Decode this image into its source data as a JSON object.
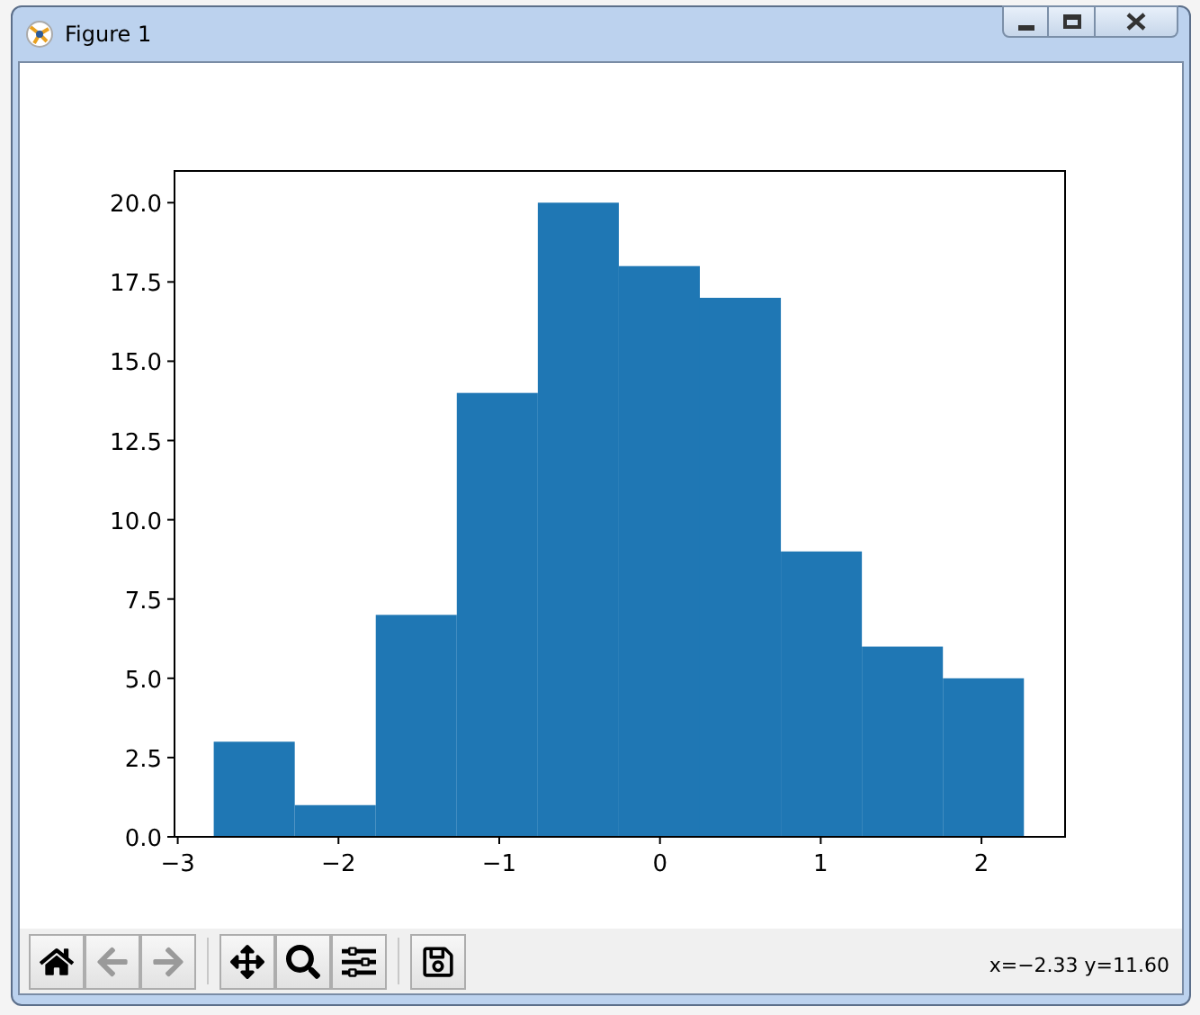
{
  "window": {
    "title": "Figure 1",
    "controls": [
      {
        "kind": "minimize"
      },
      {
        "kind": "maximize"
      },
      {
        "kind": "close"
      }
    ]
  },
  "figure": {
    "chart_data": {
      "type": "bar",
      "x": [
        -2.524,
        -2.02,
        -1.516,
        -1.012,
        -0.508,
        -0.004,
        0.5,
        1.004,
        1.508,
        2.012
      ],
      "values": [
        3,
        1,
        7,
        14,
        20,
        18,
        17,
        9,
        6,
        5
      ],
      "color": "#1f77b4",
      "xlim": [
        -3.02,
        2.52
      ],
      "ylim": [
        0,
        21
      ],
      "xticks": [
        {
          "value": -3,
          "label": "−3"
        },
        {
          "value": -2,
          "label": "−2"
        },
        {
          "value": -1,
          "label": "−1"
        },
        {
          "value": 0,
          "label": "0"
        },
        {
          "value": 1,
          "label": "1"
        },
        {
          "value": 2,
          "label": "2"
        }
      ],
      "yticks": [
        {
          "value": 0,
          "label": "0.0"
        },
        {
          "value": 2.5,
          "label": "2.5"
        },
        {
          "value": 5,
          "label": "5.0"
        },
        {
          "value": 7.5,
          "label": "7.5"
        },
        {
          "value": 10,
          "label": "10.0"
        },
        {
          "value": 12.5,
          "label": "12.5"
        },
        {
          "value": 15,
          "label": "15.0"
        },
        {
          "value": 17.5,
          "label": "17.5"
        },
        {
          "value": 20,
          "label": "20.0"
        }
      ]
    }
  },
  "toolbar": {
    "groups": [
      [
        {
          "kind": "home",
          "disabled": false
        },
        {
          "kind": "back",
          "disabled": true
        },
        {
          "kind": "forward",
          "disabled": true
        }
      ],
      [
        {
          "kind": "pan",
          "disabled": false
        },
        {
          "kind": "zoom",
          "disabled": false
        },
        {
          "kind": "configure",
          "disabled": false
        }
      ],
      [
        {
          "kind": "save",
          "disabled": false
        }
      ]
    ],
    "coordinates": "x=−2.33 y=11.60"
  }
}
